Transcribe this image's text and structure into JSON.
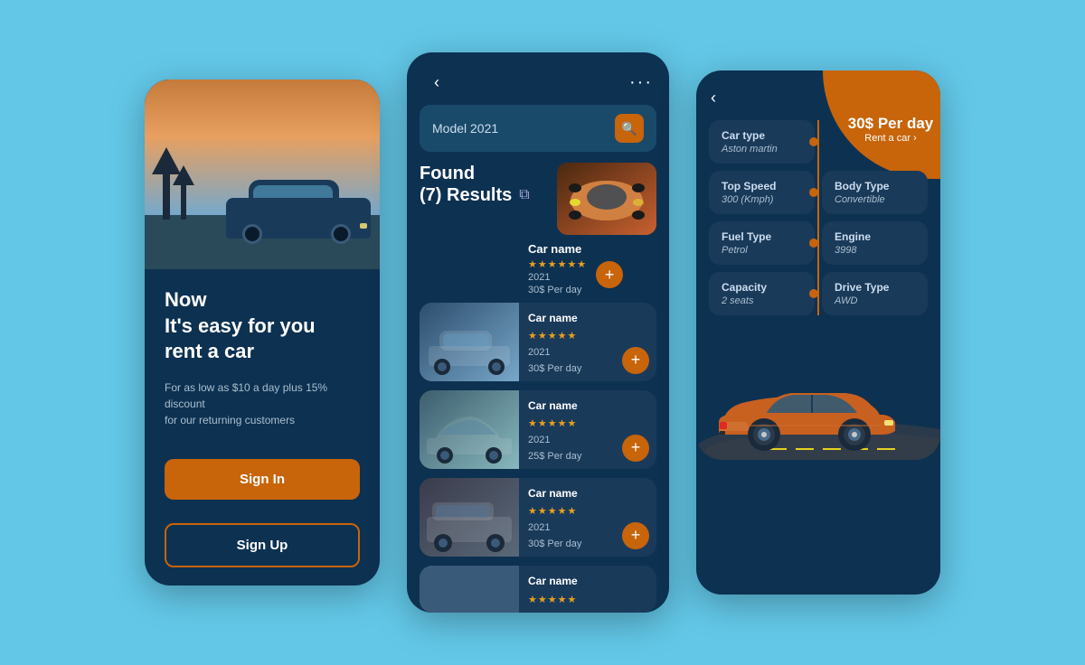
{
  "card1": {
    "title": "Now\nIt's easy for you\nrent a car",
    "subtitle": "For as low as $10 a day plus 15% discount\nfor our returning customers",
    "signin_label": "Sign In",
    "signup_label": "Sign Up"
  },
  "card2": {
    "back_icon": "‹",
    "dots_icon": "···",
    "search_value": "Model 2021",
    "search_placeholder": "Model 2021",
    "results_text": "Found\n(7) Results",
    "filter_icon": "⊞",
    "featured": {
      "name": "Car name",
      "stars": "★★★★★★",
      "year": "2021",
      "price": "30$ Per day"
    },
    "items": [
      {
        "name": "Car name",
        "stars": "★★★★★",
        "year": "2021",
        "price": "30$ Per day"
      },
      {
        "name": "Car name",
        "stars": "★★★★★",
        "year": "2021",
        "price": "25$ Per day"
      },
      {
        "name": "Car name",
        "stars": "★★★★★",
        "year": "2021",
        "price": "30$ Per day"
      }
    ]
  },
  "card3": {
    "back_icon": "‹",
    "price": "30$ Per day",
    "rent_label": "Rent a car ›",
    "specs": [
      {
        "label": "Car type",
        "value": "Aston martin"
      },
      {
        "label": "Top Speed",
        "value": "300 (Kmph)"
      },
      {
        "label": "Body Type",
        "value": "Convertible"
      },
      {
        "label": "Fuel Type",
        "value": "Petrol"
      },
      {
        "label": "Engine",
        "value": "3998"
      },
      {
        "label": "Capacity",
        "value": "2 seats"
      },
      {
        "label": "Drive Type",
        "value": "AWD"
      }
    ]
  }
}
